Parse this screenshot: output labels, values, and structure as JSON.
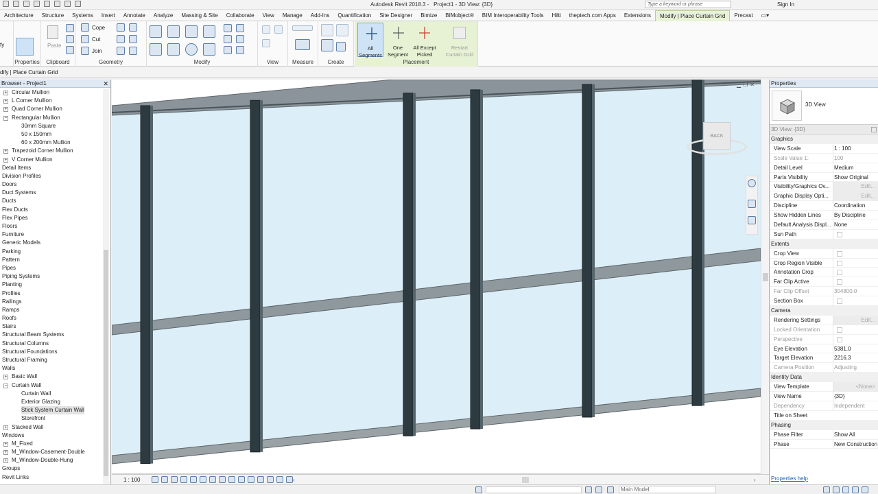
{
  "title_bar": {
    "title": "Autodesk Revit 2018.3 -",
    "document": "Project1 - 3D View: {3D}",
    "search_placeholder": "Type a keyword or phrase",
    "sign_in": "Sign In"
  },
  "ribbon_tabs": [
    "Architecture",
    "Structure",
    "Systems",
    "Insert",
    "Annotate",
    "Analyze",
    "Massing & Site",
    "Collaborate",
    "View",
    "Manage",
    "Add-Ins",
    "Quantification",
    "Site Designer",
    "Bimize",
    "BIMobject®",
    "BIM Interoperability Tools",
    "Hilti",
    "theptech.com Apps",
    "Extensions",
    "Modify | Place Curtain Grid",
    "Precast"
  ],
  "active_tab": "Modify | Place Curtain Grid",
  "ribbon": {
    "modify_stub": "fy",
    "properties_label": "Properties",
    "clipboard_label": "Clipboard",
    "paste_label": "Paste",
    "cope_label": "Cope",
    "cut_label": "Cut",
    "join_label": "Join",
    "geometry_label": "Geometry",
    "modify_label": "Modify",
    "view_label": "View",
    "measure_label": "Measure",
    "create_label": "Create",
    "placement_label": "Placement",
    "all_segments_1": "All",
    "all_segments_2": "Segments",
    "one_segment_1": "One",
    "one_segment_2": "Segment",
    "all_except_1": "All Except",
    "all_except_2": "Picked",
    "restart_1": "Restart",
    "restart_2": "Curtain Grid"
  },
  "options_bar": "dify | Place Curtain Grid",
  "browser": {
    "title": "Browser - Project1",
    "items": [
      {
        "label": "Circular Mullion",
        "level": 1,
        "toggle": "+"
      },
      {
        "label": "L Corner Mullion",
        "level": 1,
        "toggle": "+"
      },
      {
        "label": "Quad Corner Mullion",
        "level": 1,
        "toggle": "+"
      },
      {
        "label": "Rectangular Mullion",
        "level": 1,
        "toggle": "-"
      },
      {
        "label": "30mm Square",
        "level": 2,
        "toggle": ""
      },
      {
        "label": "50 x 150mm",
        "level": 2,
        "toggle": ""
      },
      {
        "label": "60 x 200mm Mullion",
        "level": 2,
        "toggle": ""
      },
      {
        "label": "Trapezoid Corner Mullion",
        "level": 1,
        "toggle": "+"
      },
      {
        "label": "V Corner Mullion",
        "level": 1,
        "toggle": "+"
      },
      {
        "label": "Detail Items",
        "level": 0,
        "toggle": ""
      },
      {
        "label": "Division Profiles",
        "level": 0,
        "toggle": ""
      },
      {
        "label": "Doors",
        "level": 0,
        "toggle": ""
      },
      {
        "label": "Duct Systems",
        "level": 0,
        "toggle": ""
      },
      {
        "label": "Ducts",
        "level": 0,
        "toggle": ""
      },
      {
        "label": "Flex Ducts",
        "level": 0,
        "toggle": ""
      },
      {
        "label": "Flex Pipes",
        "level": 0,
        "toggle": ""
      },
      {
        "label": "Floors",
        "level": 0,
        "toggle": ""
      },
      {
        "label": "Furniture",
        "level": 0,
        "toggle": ""
      },
      {
        "label": "Generic Models",
        "level": 0,
        "toggle": ""
      },
      {
        "label": "Parking",
        "level": 0,
        "toggle": ""
      },
      {
        "label": "Pattern",
        "level": 0,
        "toggle": ""
      },
      {
        "label": "Pipes",
        "level": 0,
        "toggle": ""
      },
      {
        "label": "Piping Systems",
        "level": 0,
        "toggle": ""
      },
      {
        "label": "Planting",
        "level": 0,
        "toggle": ""
      },
      {
        "label": "Profiles",
        "level": 0,
        "toggle": ""
      },
      {
        "label": "Railings",
        "level": 0,
        "toggle": ""
      },
      {
        "label": "Ramps",
        "level": 0,
        "toggle": ""
      },
      {
        "label": "Roofs",
        "level": 0,
        "toggle": ""
      },
      {
        "label": "Stairs",
        "level": 0,
        "toggle": ""
      },
      {
        "label": "Structural Beam Systems",
        "level": 0,
        "toggle": ""
      },
      {
        "label": "Structural Columns",
        "level": 0,
        "toggle": ""
      },
      {
        "label": "Structural Foundations",
        "level": 0,
        "toggle": ""
      },
      {
        "label": "Structural Framing",
        "level": 0,
        "toggle": ""
      },
      {
        "label": "Walls",
        "level": 0,
        "toggle": ""
      },
      {
        "label": "Basic Wall",
        "level": 1,
        "toggle": "+"
      },
      {
        "label": "Curtain Wall",
        "level": 1,
        "toggle": "-"
      },
      {
        "label": "Curtain Wall",
        "level": 2,
        "toggle": ""
      },
      {
        "label": "Exterior Glazing",
        "level": 2,
        "toggle": ""
      },
      {
        "label": "Stick System Curtain Wall",
        "level": 2,
        "toggle": "",
        "selected": true
      },
      {
        "label": "Storefront",
        "level": 2,
        "toggle": ""
      },
      {
        "label": "Stacked Wall",
        "level": 1,
        "toggle": "+"
      },
      {
        "label": "Windows",
        "level": 0,
        "toggle": ""
      },
      {
        "label": "M_Fixed",
        "level": 1,
        "toggle": "+"
      },
      {
        "label": "M_Window-Casement-Double",
        "level": 1,
        "toggle": "+"
      },
      {
        "label": "M_Window-Double-Hung",
        "level": 1,
        "toggle": "+"
      },
      {
        "label": "Groups",
        "level": 0,
        "toggle": ""
      },
      {
        "label": "Revit Links",
        "level": 0,
        "toggle": ""
      }
    ]
  },
  "viewcube_label": "BACK",
  "view_control_bar": {
    "scale": "1 : 100"
  },
  "status_bar": {
    "model": "Main Model"
  },
  "properties": {
    "title": "Properties",
    "type_name": "3D View",
    "instance_selector": "3D View: {3D}",
    "rows": [
      {
        "group": "Graphics"
      },
      {
        "key": "View Scale",
        "value": "1 : 100"
      },
      {
        "key": "Scale Value    1:",
        "value": "100",
        "disabled": true
      },
      {
        "key": "Detail Level",
        "value": "Medium"
      },
      {
        "key": "Parts Visibility",
        "value": "Show Original"
      },
      {
        "key": "Visibility/Graphics Ov...",
        "value": "Edit...",
        "button": true
      },
      {
        "key": "Graphic Display Opti...",
        "value": "Edit...",
        "button": true
      },
      {
        "key": "Discipline",
        "value": "Coordination"
      },
      {
        "key": "Show Hidden Lines",
        "value": "By Discipline"
      },
      {
        "key": "Default Analysis Displ...",
        "value": "None"
      },
      {
        "key": "Sun Path",
        "check": true
      },
      {
        "group": "Extents"
      },
      {
        "key": "Crop View",
        "check": true
      },
      {
        "key": "Crop Region Visible",
        "check": true
      },
      {
        "key": "Annotation Crop",
        "check": true
      },
      {
        "key": "Far Clip Active",
        "check": true
      },
      {
        "key": "Far Clip Offset",
        "value": "304800.0",
        "disabled": true
      },
      {
        "key": "Section Box",
        "check": true
      },
      {
        "group": "Camera"
      },
      {
        "key": "Rendering Settings",
        "value": "Edit...",
        "button": true
      },
      {
        "key": "Locked Orientation",
        "check": true,
        "disabled": true
      },
      {
        "key": "Perspective",
        "check": true,
        "disabled": true
      },
      {
        "key": "Eye Elevation",
        "value": "5381.0"
      },
      {
        "key": "Target Elevation",
        "value": "2216.3"
      },
      {
        "key": "Camera Position",
        "value": "Adjusting",
        "disabled": true
      },
      {
        "group": "Identity Data"
      },
      {
        "key": "View Template",
        "value": "<None>",
        "button": true
      },
      {
        "key": "View Name",
        "value": "{3D}"
      },
      {
        "key": "Dependency",
        "value": "Independent",
        "disabled": true
      },
      {
        "key": "Title on Sheet",
        "value": ""
      },
      {
        "group": "Phasing"
      },
      {
        "key": "Phase Filter",
        "value": "Show All"
      },
      {
        "key": "Phase",
        "value": "New Construction"
      }
    ],
    "help_link": "Properties help"
  }
}
